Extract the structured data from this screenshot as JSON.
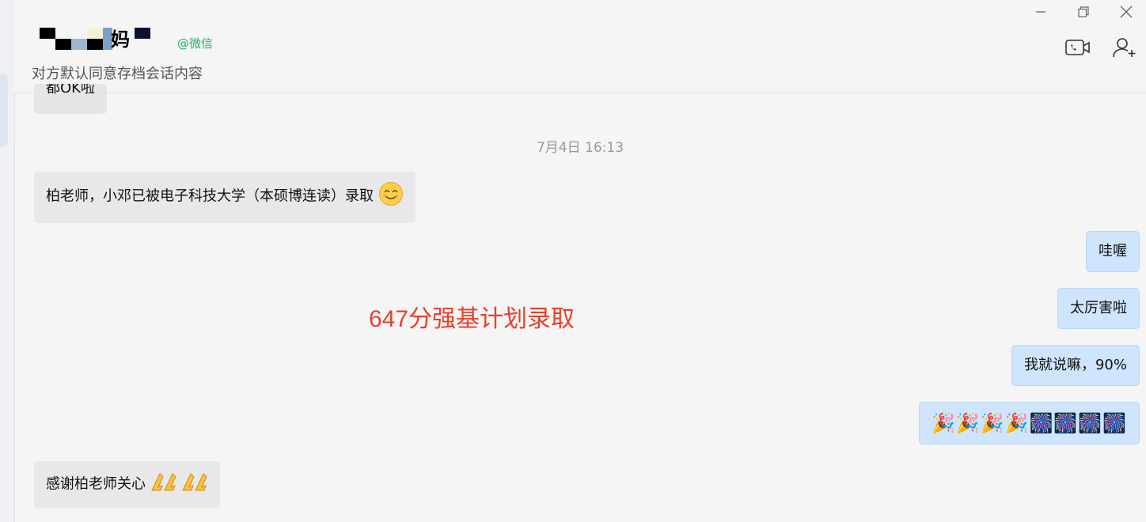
{
  "header": {
    "contact_name": "妈",
    "wechat_tag": "@微信",
    "subtitle": "对方默认同意存档会话内容",
    "icons": [
      "minimize-icon",
      "restore-icon",
      "close-icon",
      "video-call-icon",
      "add-contact-icon"
    ]
  },
  "messages": {
    "partial_top": "都OK啦",
    "timestamp": "7月4日 16:13",
    "m1": "柏老师，小邓已被电子科技大学（本硕博连读）录取",
    "m2": "哇喔",
    "m3": "太厉害啦",
    "m4": "我就说嘛，90%",
    "m5": "🎉🎉🎉🎉🎆🎆🎆🎆",
    "m6": "感谢柏老师关心"
  },
  "overlay": {
    "caption": "647分强基计划录取"
  },
  "colors": {
    "incoming_bubble": "#e8e8e8",
    "outgoing_bubble": "#cfe4fd",
    "wechat_green": "#2aae67",
    "caption_red": "#e8402a"
  }
}
